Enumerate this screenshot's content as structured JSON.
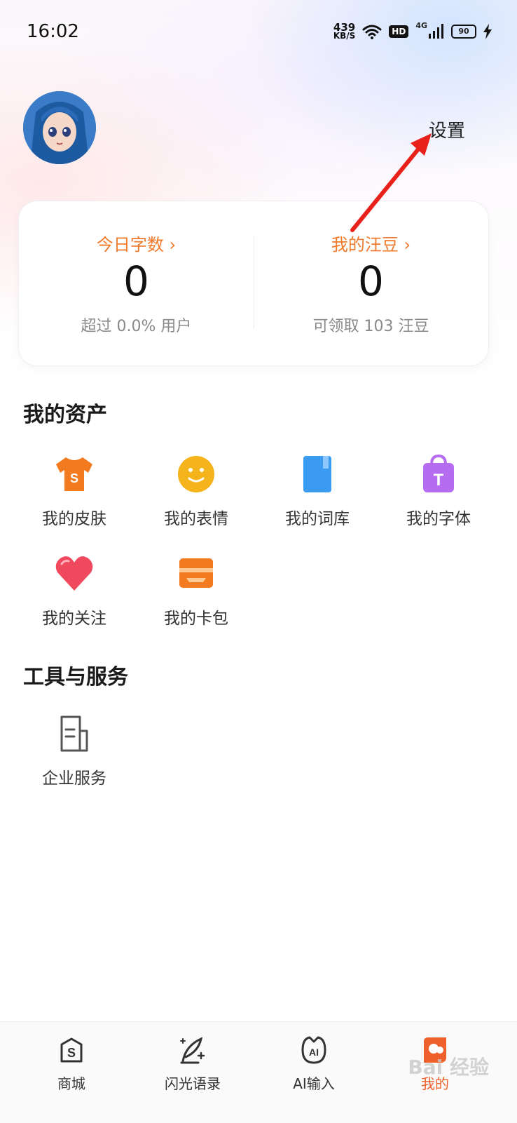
{
  "status_bar": {
    "time": "16:02",
    "net_speed_value": "439",
    "net_speed_unit": "KB/S",
    "hd_label": "HD",
    "network_label": "4G",
    "battery_level": "90"
  },
  "header": {
    "settings_label": "设置"
  },
  "stats": {
    "left": {
      "label": "今日字数 ›",
      "value": "0",
      "sub": "超过 0.0% 用户"
    },
    "right": {
      "label": "我的汪豆 ›",
      "value": "0",
      "sub": "可领取 103 汪豆"
    }
  },
  "assets": {
    "title": "我的资产",
    "items": [
      {
        "label": "我的皮肤",
        "icon": "tshirt-icon",
        "color": "#f47a20"
      },
      {
        "label": "我的表情",
        "icon": "smiley-icon",
        "color": "#f5b31c"
      },
      {
        "label": "我的词库",
        "icon": "book-icon",
        "color": "#3a9bf0"
      },
      {
        "label": "我的字体",
        "icon": "font-bag-icon",
        "color": "#b56cf0"
      },
      {
        "label": "我的关注",
        "icon": "heart-icon",
        "color": "#f0485c"
      },
      {
        "label": "我的卡包",
        "icon": "card-wallet-icon",
        "color": "#f47a20"
      }
    ]
  },
  "services": {
    "title": "工具与服务",
    "items": [
      {
        "label": "企业服务",
        "icon": "document-icon"
      }
    ]
  },
  "bottom_nav": {
    "items": [
      {
        "label": "商城",
        "icon": "store-icon"
      },
      {
        "label": "闪光语录",
        "icon": "quill-icon"
      },
      {
        "label": "AI输入",
        "icon": "ai-icon"
      },
      {
        "label": "我的",
        "icon": "profile-icon",
        "active": true
      }
    ]
  },
  "colors": {
    "accent": "#f07a2c",
    "annotation_arrow": "#e8211b"
  },
  "watermark": "Bai 经验"
}
